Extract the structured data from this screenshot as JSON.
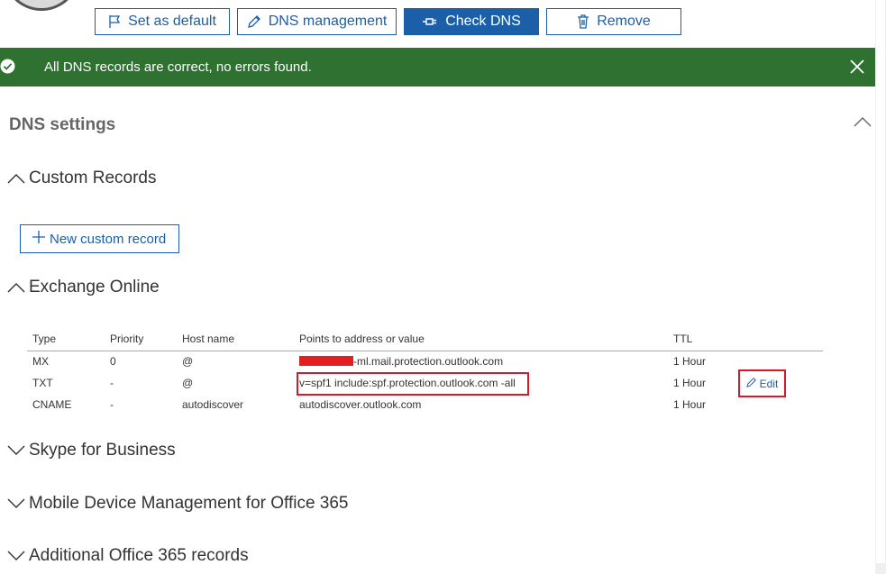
{
  "toolbar": {
    "set_default": "Set as default",
    "dns_management": "DNS management",
    "check_dns": "Check DNS",
    "remove": "Remove"
  },
  "banner": {
    "message": "All DNS records are correct, no errors found."
  },
  "dns_settings": {
    "title": "DNS settings"
  },
  "groups": {
    "custom_records": "Custom Records",
    "new_custom_record": "New custom record",
    "exchange_online": "Exchange Online",
    "skype": "Skype for Business",
    "mdm": "Mobile Device Management for Office 365",
    "additional": "Additional Office 365 records"
  },
  "table": {
    "headers": [
      "Type",
      "Priority",
      "Host name",
      "Points to address or value",
      "TTL"
    ],
    "rows": [
      {
        "type": "MX",
        "priority": "0",
        "host": "@",
        "value": "-ml.mail.protection.outlook.com",
        "ttl": "1 Hour"
      },
      {
        "type": "TXT",
        "priority": "-",
        "host": "@",
        "value": "v=spf1 include:spf.protection.outlook.com -all",
        "ttl": "1 Hour"
      },
      {
        "type": "CNAME",
        "priority": "-",
        "host": "autodiscover",
        "value": "autodiscover.outlook.com",
        "ttl": "1 Hour"
      }
    ],
    "edit_label": "Edit"
  },
  "colors": {
    "accent": "#1b5fa8",
    "success": "#2f7131",
    "highlight": "#d9182b"
  }
}
